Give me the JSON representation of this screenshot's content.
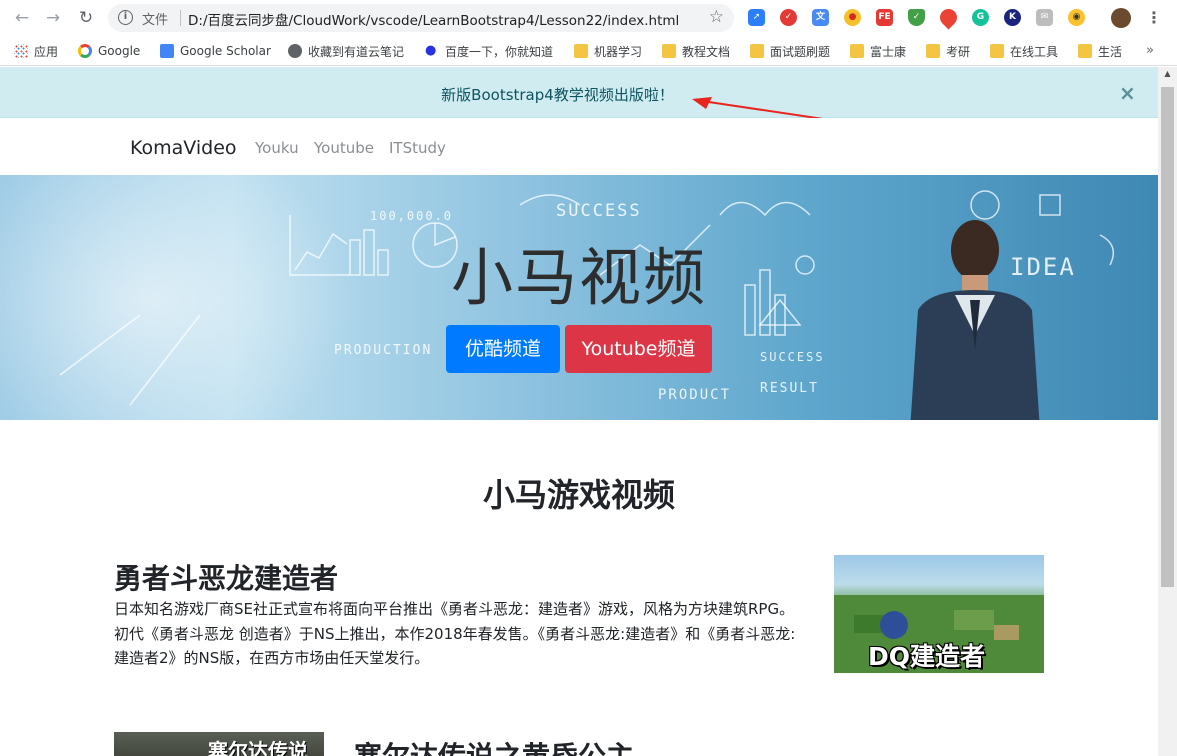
{
  "browser": {
    "omnibox": {
      "file_label": "文件",
      "url": "D:/百度云同步盘/CloudWork/vscode/LearnBootstrap4/Lesson22/index.html"
    },
    "bookmarks": [
      {
        "label": "应用",
        "icon": "apps-grid-icon"
      },
      {
        "label": "Google",
        "icon": "google-icon"
      },
      {
        "label": "Google Scholar",
        "icon": "scholar-icon"
      },
      {
        "label": "收藏到有道云笔记",
        "icon": "globe-icon"
      },
      {
        "label": "百度一下，你就知道",
        "icon": "baidu-paw-icon"
      },
      {
        "label": "机器学习",
        "icon": "folder-icon"
      },
      {
        "label": "教程文档",
        "icon": "folder-icon"
      },
      {
        "label": "面试题刷题",
        "icon": "folder-icon"
      },
      {
        "label": "富士康",
        "icon": "folder-icon"
      },
      {
        "label": "考研",
        "icon": "folder-icon"
      },
      {
        "label": "在线工具",
        "icon": "folder-icon"
      },
      {
        "label": "生活",
        "icon": "folder-icon"
      }
    ],
    "bookmarks_more": "»",
    "extensions": {
      "fe_label": "FE",
      "g_label": "G",
      "k_label": "K"
    }
  },
  "page": {
    "alert": {
      "text": "新版Bootstrap4教学视频出版啦！",
      "close": "×"
    },
    "navbar": {
      "brand": "KomaVideo",
      "links": [
        "Youku",
        "Youtube",
        "ITStudy"
      ]
    },
    "hero": {
      "title": "小马视频",
      "primary_button": "优酷频道",
      "danger_button": "Youtube频道",
      "doodles": [
        "SUCCESS",
        "IDEA",
        "PRODUCTION",
        "PRODUCT",
        "RESULT",
        "SUCCESS",
        "100,000.0"
      ]
    },
    "section_title": "小马游戏视频",
    "items": [
      {
        "title": "勇者斗恶龙建造者",
        "description": "日本知名游戏厂商SE社正式宣布将面向平台推出《勇者斗恶龙：建造者》游戏，风格为方块建筑RPG。初代《勇者斗恶龙 创造者》于NS上推出，本作2018年春发售。《勇者斗恶龙:建造者》和《勇者斗恶龙:建造者2》的NS版，在西方市场由任天堂发行。",
        "thumbnail_caption": "DQ建造者"
      },
      {
        "title": "塞尔达传说之黄昏公主",
        "thumbnail_caption": "塞尔达传说"
      }
    ]
  },
  "colors": {
    "alert_bg": "#d1ecf1",
    "alert_text": "#0c5460",
    "primary": "#007bff",
    "danger": "#dc3545",
    "arrow": "#e8261e"
  }
}
